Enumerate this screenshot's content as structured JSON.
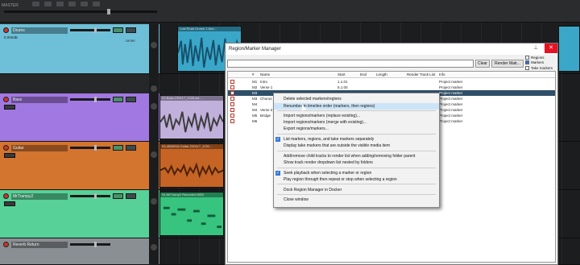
{
  "topbar": {
    "master_label": "MASTER"
  },
  "tracks": [
    {
      "name": "Drums",
      "sub": "0.000dB",
      "sub2": "center",
      "color": "#6dc0d8"
    },
    {
      "name": "Bass",
      "sub": "",
      "sub2": "",
      "color": "#a178e2"
    },
    {
      "name": "Guitar",
      "sub": "",
      "sub2": "",
      "color": "#d3742f"
    },
    {
      "name": "MrTrampy2",
      "sub": "",
      "sub2": "",
      "color": "#57d197"
    },
    {
      "name": "Reverb Return",
      "sub": "",
      "sub2": "",
      "color": "#8a8f93"
    }
  ],
  "items": {
    "drums": "Lost Road Drums 1 Ana...",
    "bass": "02-Bass-230117_1226.wa...",
    "guitar": "03-4568016-Guitar-230117_1231...",
    "midi": "04-MrTramp2 Recorded MIDI"
  },
  "dialog": {
    "title": "Region/Marker Manager",
    "close": "✕",
    "pin": "⊥",
    "filter_placeholder": "",
    "clear_label": "Clear",
    "render_label": "Render Matr...",
    "checks": [
      {
        "label": "Regions",
        "on": false
      },
      {
        "label": "Markers",
        "on": true
      },
      {
        "label": "Take markers",
        "on": false
      }
    ],
    "columns": [
      "#",
      "Name",
      "Start",
      "End",
      "Length",
      "Render Track List",
      "Info"
    ],
    "rows": [
      {
        "num": "M1",
        "name": "Intro",
        "start": "1.1.01",
        "end": "",
        "length": "",
        "info": "Project marker",
        "sel": false
      },
      {
        "num": "M2",
        "name": "Verse 1",
        "start": "5.1.00",
        "end": "",
        "length": "",
        "info": "Project marker",
        "sel": false
      },
      {
        "num": "M3",
        "name": "",
        "start": "",
        "end": "",
        "length": "",
        "info": "Project marker",
        "sel": true
      },
      {
        "num": "M3",
        "name": "Chorus",
        "start": "",
        "end": "",
        "length": "",
        "info": "Project marker",
        "sel": false
      },
      {
        "num": "M4",
        "name": "",
        "start": "",
        "end": "",
        "length": "",
        "info": "Project marker",
        "sel": false
      },
      {
        "num": "M4",
        "name": "Verse 2",
        "start": "",
        "end": "",
        "length": "",
        "info": "Project marker",
        "sel": false
      },
      {
        "num": "M5",
        "name": "Bridge",
        "start": "",
        "end": "",
        "length": "",
        "info": "Project marker",
        "sel": false
      },
      {
        "num": "M6",
        "name": "",
        "start": "",
        "end": "",
        "length": "",
        "info": "Project marker",
        "sel": false
      }
    ]
  },
  "menu": {
    "items": [
      {
        "label": "Delete selected markers/regions",
        "checked": false,
        "hl": false
      },
      {
        "label": "Renumber in timeline order (markers, then regions)",
        "checked": false,
        "hl": true
      },
      {
        "label": "Import regions/markers (replace existing)...",
        "checked": false,
        "hl": false
      },
      {
        "label": "Import regions/markers (merge with existing)...",
        "checked": false,
        "hl": false
      },
      {
        "label": "Export regions/markers...",
        "checked": false,
        "hl": false
      },
      {
        "label": "List markers, regions, and take markers separately",
        "checked": true,
        "hl": false
      },
      {
        "label": "Display take markers that are outside the visible media item",
        "checked": false,
        "hl": false
      },
      {
        "label": "Add/remove child tracks to render list when adding/removing folder parent",
        "checked": false,
        "hl": false
      },
      {
        "label": "Show track render dropdown list nested by folders",
        "checked": false,
        "hl": false
      },
      {
        "label": "Seek playback when selecting a marker or region",
        "checked": true,
        "hl": false
      },
      {
        "label": "Play region through then repeat or stop when selecting a region",
        "checked": false,
        "hl": false
      },
      {
        "label": "Dock Region Manager in Docker",
        "checked": false,
        "hl": false
      },
      {
        "label": "Close window",
        "checked": false,
        "hl": false
      }
    ]
  }
}
